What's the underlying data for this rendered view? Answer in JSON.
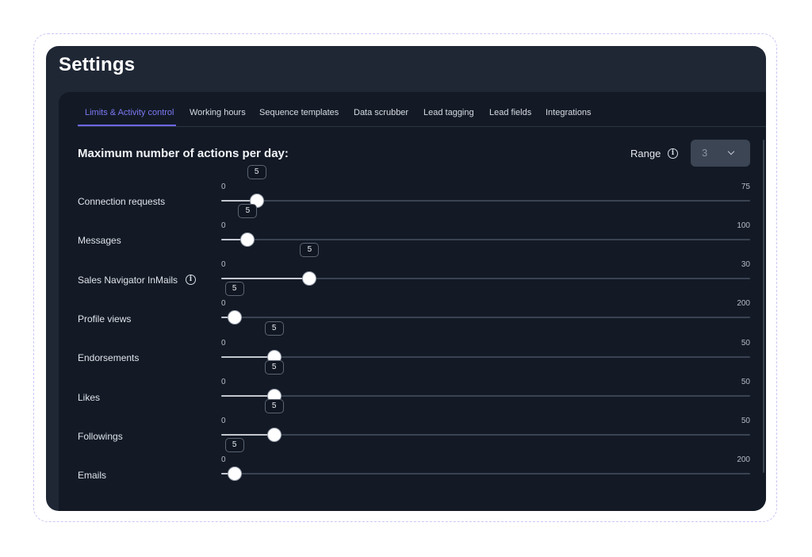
{
  "page": {
    "title": "Settings"
  },
  "tabs": [
    {
      "label": "Limits & Activity control",
      "active": true
    },
    {
      "label": "Working hours"
    },
    {
      "label": "Sequence templates"
    },
    {
      "label": "Data scrubber"
    },
    {
      "label": "Lead tagging"
    },
    {
      "label": "Lead fields"
    },
    {
      "label": "Integrations"
    }
  ],
  "limits": {
    "heading": "Maximum number of actions per day:",
    "range_label": "Range",
    "range_value": "3",
    "info_icon": "info-icon",
    "rows": [
      {
        "label": "Connection requests",
        "min": "0",
        "max": "75",
        "value": "5",
        "fill": 0.067
      },
      {
        "label": "Messages",
        "min": "0",
        "max": "100",
        "value": "5",
        "fill": 0.05
      },
      {
        "label": "Sales Navigator InMails",
        "min": "0",
        "max": "30",
        "value": "5",
        "fill": 0.167,
        "has_info": true
      },
      {
        "label": "Profile views",
        "min": "0",
        "max": "200",
        "value": "5",
        "fill": 0.025
      },
      {
        "label": "Endorsements",
        "min": "0",
        "max": "50",
        "value": "5",
        "fill": 0.1
      },
      {
        "label": "Likes",
        "min": "0",
        "max": "50",
        "value": "5",
        "fill": 0.1
      },
      {
        "label": "Followings",
        "min": "0",
        "max": "50",
        "value": "5",
        "fill": 0.1
      },
      {
        "label": "Emails",
        "min": "0",
        "max": "200",
        "value": "5",
        "fill": 0.025
      }
    ]
  },
  "colors": {
    "accent": "#7c78f3",
    "window_bg": "#1f2735",
    "panel_bg": "#131a26"
  }
}
